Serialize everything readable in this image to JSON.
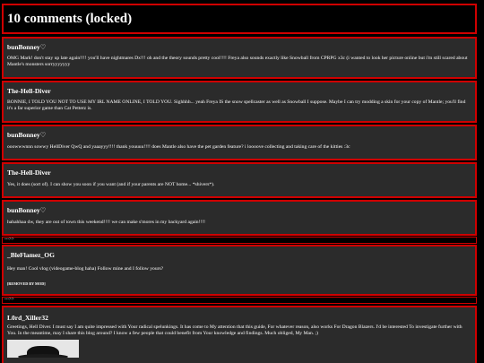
{
  "page": {
    "title": "10 comments (locked)"
  },
  "comments": [
    {
      "author": "bunBonney♡",
      "text": "OMG Mark! don't stay up late again!!!! you'll have nightmares Dx!!! oh and the theory sounds pretty cool!!!! Freya also sounds exactly like Snowball from CPRPG x3c (i wanted to look her picture online but i'm still scared about Mantle's monsters sorryyyyyyy"
    },
    {
      "author": "The-Hell-Diver",
      "text": "BONNIE, I TOLD YOU NOT TO USE MY IRL NAME ONLINE, I TOLD YOU. Sighhhh... yeah Freya IS the snow spellcaster as well as Snowball I suppose. Maybe I can try modding a skin for your copy of Mantle; you'll find it's a far superior game than Cat Petterz is."
    },
    {
      "author": "bunBonney♡",
      "text": "ooowwwnnn sowwy HellDiver QwQ and yaaayyy!!!! thank youuuu!!!! does Mantle also have the pet garden feature? i loooove collecting and taking care of the kitties :3c"
    },
    {
      "author": "The-Hell-Diver",
      "text": "Yes, it does (sort of). I can show you soon if you want (and if your parents are NOT home... *shivers*)."
    },
    {
      "author": "bunBonney♡",
      "text": "hahahhaa dw, they are out of town this weekend!!!! we can make s'mores in my backyard again!!!!"
    },
    {
      "author": "_BleFlamez_OG",
      "text": "Hey man! Cool vlog (videogame-blog haha) Follow mine and I follow yours?",
      "removed": "[REMOVED BY MOD]"
    },
    {
      "author": "L0rd_Xiller32",
      "text": "Greetings, Hell Diver. I must say I am quite impressed with Your radical spelunkings. It has come to My attention that this guide, For whatever reason, also works For Dragon Blazers. I'd be interested To investigate further with You. In the meantime, may I share this blog around? I know a few people that could benefit from Your knowledge and findings. Much obliged, My Man. ;)"
    }
  ],
  "reply_toggles": [
    "--->>",
    "--->>"
  ],
  "icons": {
    "avatar": "black-hat-avatar"
  },
  "colors": {
    "border": "#d00000",
    "panel": "#2b2b2b",
    "background": "#000000"
  }
}
